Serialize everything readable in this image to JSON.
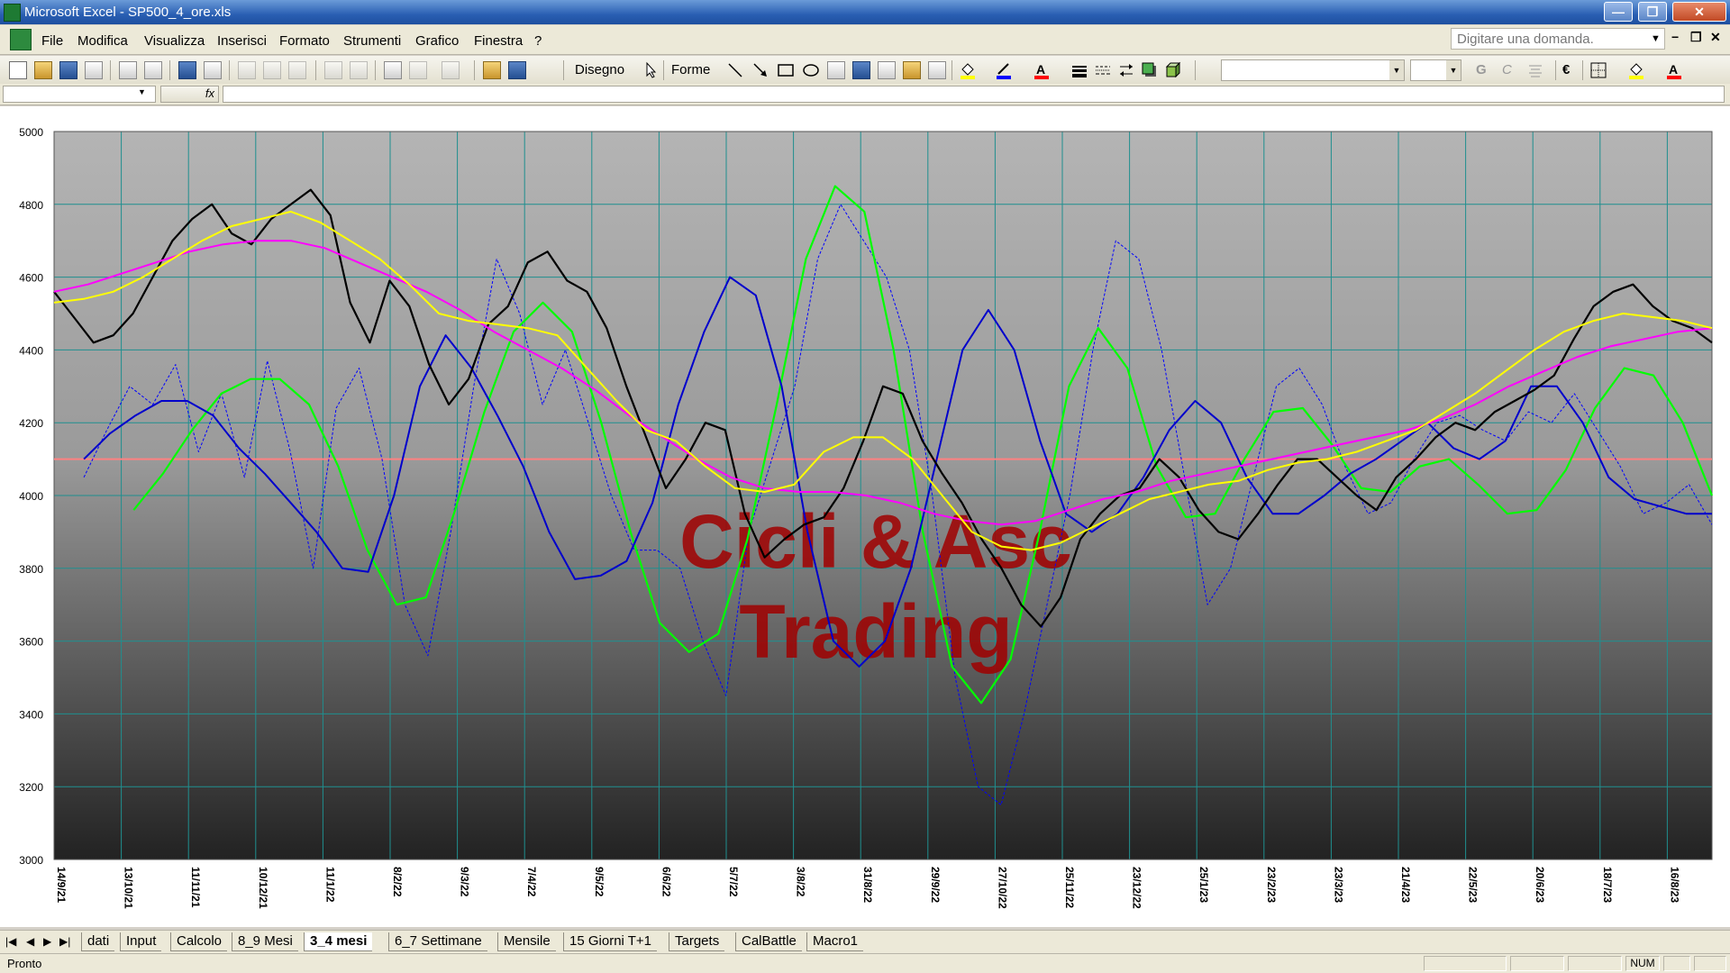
{
  "window": {
    "title": "Microsoft Excel - SP500_4_ore.xls",
    "minimize": "—",
    "restore": "❐",
    "close": "✕"
  },
  "menu": {
    "items": [
      "File",
      "Modifica",
      "Visualizza",
      "Inserisci",
      "Formato",
      "Strumenti",
      "Grafico",
      "Finestra",
      "?"
    ],
    "help_placeholder": "Digitare una domanda."
  },
  "toolbar": {
    "draw_label": "Disegno",
    "shapes_label": "Forme",
    "bold": "G",
    "italic": "C",
    "euro": "€"
  },
  "formula_bar": {
    "fx": "fx"
  },
  "chart_data": {
    "type": "line",
    "watermark": [
      "Cicli & Asc",
      "Trading"
    ],
    "ylim": [
      3000,
      5000
    ],
    "yticks": [
      3000,
      3200,
      3400,
      3600,
      3800,
      4000,
      4200,
      4400,
      4600,
      4800,
      5000
    ],
    "xticks": [
      "14/9/21",
      "13/10/21",
      "11/11/21",
      "10/12/21",
      "11/1/22",
      "8/2/22",
      "9/3/22",
      "7/4/22",
      "9/5/22",
      "6/6/22",
      "5/7/22",
      "3/8/22",
      "31/8/22",
      "29/9/22",
      "27/10/22",
      "25/11/22",
      "23/12/22",
      "25/1/23",
      "23/2/23",
      "23/3/23",
      "21/4/23",
      "22/5/23",
      "20/6/23",
      "18/7/23",
      "16/8/23"
    ],
    "reference_line": 4100,
    "colors": {
      "price": "#000000",
      "ma_fast": "#ffff00",
      "ma_slow": "#ff00ff",
      "cycle_green": "#00ff00",
      "blue": "#0000cc",
      "blue_dotted": "#0000ff",
      "reference": "#ff8080"
    },
    "series": [
      {
        "key": "price",
        "values": [
          4560,
          4490,
          4420,
          4440,
          4500,
          4600,
          4700,
          4760,
          4800,
          4720,
          4690,
          4760,
          4800,
          4840,
          4770,
          4530,
          4420,
          4590,
          4520,
          4360,
          4250,
          4320,
          4470,
          4520,
          4640,
          4670,
          4590,
          4560,
          4460,
          4300,
          4160,
          4020,
          4100,
          4200,
          4180,
          3950,
          3830,
          3880,
          3920,
          3940,
          4020,
          4150,
          4300,
          4280,
          4150,
          4060,
          3980,
          3880,
          3800,
          3700,
          3640,
          3720,
          3880,
          3950,
          4000,
          4020,
          4100,
          4050,
          3960,
          3900,
          3880,
          3950,
          4030,
          4100,
          4100,
          4050,
          4000,
          3960,
          4050,
          4100,
          4160,
          4200,
          4180,
          4230,
          4260,
          4290,
          4330,
          4430,
          4520,
          4560,
          4580,
          4520,
          4480,
          4460,
          4420
        ]
      },
      {
        "key": "ma_fast",
        "values": [
          4530,
          4540,
          4560,
          4600,
          4650,
          4700,
          4740,
          4760,
          4780,
          4750,
          4700,
          4650,
          4580,
          4500,
          4480,
          4470,
          4460,
          4440,
          4350,
          4260,
          4180,
          4150,
          4080,
          4020,
          4010,
          4030,
          4120,
          4160,
          4160,
          4100,
          4000,
          3900,
          3860,
          3850,
          3870,
          3910,
          3950,
          3990,
          4010,
          4030,
          4040,
          4070,
          4090,
          4100,
          4120,
          4150,
          4180,
          4230,
          4280,
          4340,
          4400,
          4450,
          4480,
          4500,
          4490,
          4480,
          4460
        ]
      },
      {
        "key": "ma_slow",
        "values": [
          4560,
          4580,
          4610,
          4640,
          4670,
          4690,
          4700,
          4700,
          4680,
          4640,
          4600,
          4560,
          4510,
          4450,
          4400,
          4350,
          4290,
          4220,
          4160,
          4100,
          4050,
          4020,
          4010,
          4010,
          4000,
          3980,
          3950,
          3930,
          3920,
          3930,
          3960,
          3990,
          4010,
          4040,
          4060,
          4080,
          4100,
          4120,
          4140,
          4160,
          4180,
          4210,
          4250,
          4300,
          4340,
          4380,
          4410,
          4430,
          4450,
          4460
        ]
      },
      {
        "key": "cycle_green",
        "values": [
          3960,
          4060,
          4180,
          4280,
          4320,
          4320,
          4250,
          4080,
          3850,
          3700,
          3720,
          3960,
          4230,
          4450,
          4530,
          4450,
          4200,
          3900,
          3650,
          3570,
          3620,
          3880,
          4250,
          4650,
          4850,
          4780,
          4400,
          3900,
          3530,
          3430,
          3550,
          3900,
          4300,
          4460,
          4350,
          4080,
          3940,
          3950,
          4100,
          4230,
          4240,
          4140,
          4020,
          4010,
          4080,
          4100,
          4030,
          3950,
          3960,
          4070,
          4240,
          4350,
          4330,
          4200,
          4000
        ]
      },
      {
        "key": "blue",
        "values": [
          4100,
          4170,
          4220,
          4260,
          4260,
          4220,
          4130,
          4060,
          3980,
          3900,
          3800,
          3790,
          4000,
          4300,
          4440,
          4350,
          4220,
          4080,
          3900,
          3770,
          3780,
          3820,
          3980,
          4250,
          4450,
          4600,
          4550,
          4300,
          3900,
          3600,
          3530,
          3600,
          3800,
          4100,
          4400,
          4510,
          4400,
          4150,
          3950,
          3900,
          3950,
          4050,
          4180,
          4260,
          4200,
          4050,
          3950,
          3950,
          4000,
          4060,
          4100,
          4150,
          4200,
          4130,
          4100,
          4150,
          4300,
          4300,
          4200,
          4050,
          3990,
          3970,
          3950,
          3950
        ]
      },
      {
        "key": "blue_dotted",
        "values": [
          4050,
          4180,
          4300,
          4250,
          4360,
          4120,
          4280,
          4050,
          4370,
          4120,
          3800,
          4240,
          4350,
          4100,
          3700,
          3560,
          3900,
          4300,
          4650,
          4500,
          4250,
          4400,
          4200,
          4000,
          3850,
          3850,
          3800,
          3600,
          3450,
          3900,
          4100,
          4300,
          4650,
          4800,
          4700,
          4600,
          4400,
          4000,
          3500,
          3200,
          3150,
          3400,
          3700,
          4000,
          4400,
          4700,
          4650,
          4400,
          4050,
          3700,
          3800,
          4050,
          4300,
          4350,
          4250,
          4080,
          3950,
          3980,
          4100,
          4200,
          4220,
          4180,
          4150,
          4230,
          4200,
          4280,
          4180,
          4080,
          3950,
          3980,
          4030,
          3920
        ]
      }
    ]
  },
  "sheet_tabs": [
    "dati",
    "Input",
    "Calcolo",
    "8_9 Mesi",
    "3_4 mesi",
    "6_7 Settimane",
    "Mensile",
    "15 Giorni T+1",
    "Targets",
    "CalBattle",
    "Macro1"
  ],
  "active_tab": "3_4 mesi",
  "status": {
    "text": "Pronto",
    "num": "NUM"
  }
}
